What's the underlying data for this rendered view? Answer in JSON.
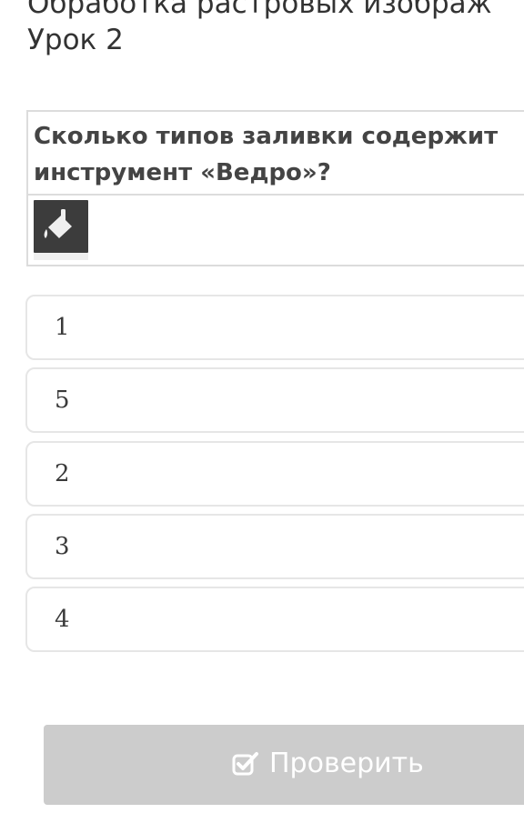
{
  "lesson": {
    "title_line1": "Обработка растровых изображ",
    "title_line2": "Урок 2"
  },
  "question": {
    "text": "Сколько типов заливки содержит инструмент «Ведро»?",
    "image_icon": "paint-bucket-icon"
  },
  "answers": [
    {
      "label": "1"
    },
    {
      "label": "5"
    },
    {
      "label": "2"
    },
    {
      "label": "3"
    },
    {
      "label": "4"
    }
  ],
  "check_button": {
    "label": "Проверить",
    "icon": "check-square-icon"
  },
  "colors": {
    "button_disabled": "#cccccc",
    "card_border": "#dcdcdc",
    "option_border": "#e6e6e6",
    "text": "#333333"
  }
}
